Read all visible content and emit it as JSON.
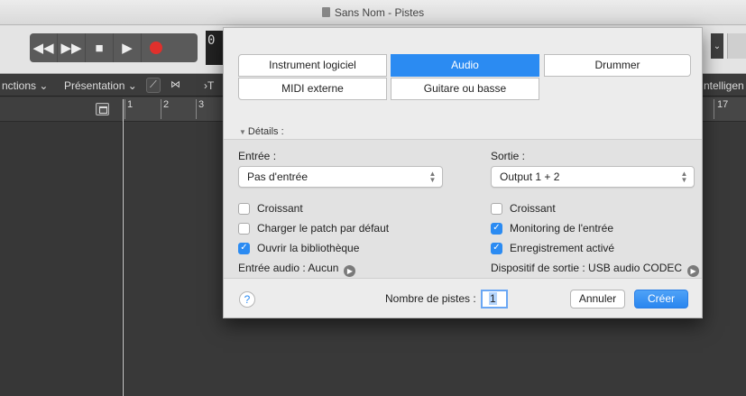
{
  "window": {
    "title": "Sans Nom - Pistes"
  },
  "background_app": {
    "lcd_text": "0",
    "menu": [
      "nctions",
      "Présentation",
      "ntelligen"
    ],
    "ruler_numbers": [
      "1",
      "2",
      "3",
      "17"
    ]
  },
  "dialog": {
    "track_types": [
      {
        "label": "Instrument logiciel",
        "selected": false
      },
      {
        "label": "Audio",
        "selected": true
      },
      {
        "label": "Drummer",
        "selected": false
      },
      {
        "label": "MIDI externe",
        "selected": false
      },
      {
        "label": "Guitare ou basse",
        "selected": false
      }
    ],
    "details_label": "Détails :",
    "input": {
      "label": "Entrée :",
      "value": "Pas d'entrée"
    },
    "output": {
      "label": "Sortie :",
      "value": "Output 1 + 2"
    },
    "left_checks": [
      {
        "label": "Croissant",
        "checked": false
      },
      {
        "label": "Charger le patch par défaut",
        "checked": false
      },
      {
        "label": "Ouvrir la bibliothèque",
        "checked": true
      }
    ],
    "right_checks": [
      {
        "label": "Croissant",
        "checked": false
      },
      {
        "label": "Monitoring de l'entrée",
        "checked": true
      },
      {
        "label": "Enregistrement activé",
        "checked": true
      }
    ],
    "audio_input_text": "Entrée audio : Aucun",
    "output_device_text": "Dispositif de sortie : USB audio CODEC",
    "track_count_label": "Nombre de pistes :",
    "track_count_value": "1",
    "cancel_label": "Annuler",
    "create_label": "Créer",
    "help_symbol": "?"
  },
  "colors": {
    "accent": "#2b8bf2",
    "record": "#e0302c"
  }
}
